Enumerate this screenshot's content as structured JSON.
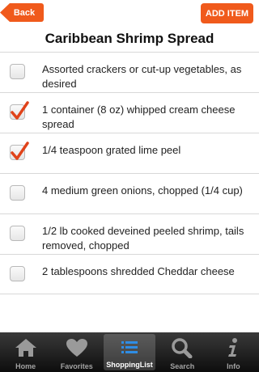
{
  "header": {
    "back_label": "Back",
    "add_label": "ADD ITEM",
    "title": "Caribbean Shrimp Spread"
  },
  "items": [
    {
      "text": " Assorted crackers or cut-up vegetables, as desired",
      "checked": false
    },
    {
      "text": "1 container (8 oz) whipped cream cheese spread",
      "checked": true
    },
    {
      "text": "1/4 teaspoon grated lime peel",
      "checked": true
    },
    {
      "text": "4 medium green onions, chopped (1/4 cup)",
      "checked": false
    },
    {
      "text": "1/2 lb cooked deveined peeled shrimp, tails removed, chopped",
      "checked": false
    },
    {
      "text": "2 tablespoons shredded Cheddar cheese",
      "checked": false
    }
  ],
  "tabs": [
    {
      "label": "Home",
      "icon": "home-icon"
    },
    {
      "label": "Favorites",
      "icon": "heart-icon"
    },
    {
      "label": "ShoppingList",
      "icon": "list-icon",
      "active": true
    },
    {
      "label": "Search",
      "icon": "search-icon"
    },
    {
      "label": "Info",
      "icon": "info-icon"
    }
  ],
  "colors": {
    "accent": "#f05a1c",
    "check": "#e0431a"
  }
}
